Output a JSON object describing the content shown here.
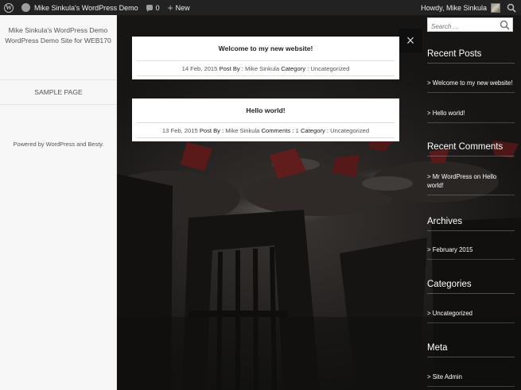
{
  "admin_bar": {
    "wp_logo": "W",
    "site_name": "Mike Sinkula's WordPress Demo",
    "comments_count": "0",
    "new_label": "New",
    "howdy": "Howdy, Mike Sinkula",
    "icons": [
      "wordpress-logo-icon",
      "dashboard-icon",
      "comment-bubble-icon",
      "plus-icon",
      "avatar",
      "search-icon"
    ]
  },
  "left_sidebar": {
    "site_title": "Mike Sinkula's WordPress Demo",
    "site_description": "WordPress Demo Site for WEB170",
    "nav": [
      {
        "label": "SAMPLE PAGE"
      }
    ],
    "powered_by": "Powered by WordPress and Besty."
  },
  "posts": [
    {
      "title": "Welcome to my new website!",
      "date": "14 Feb, 2015",
      "post_by_label": "Post By :",
      "author": "Mike Sinkula",
      "category_label": "Category :",
      "category": "Uncategorized",
      "comments_label": "",
      "comments": ""
    },
    {
      "title": "Hello world!",
      "date": "13 Feb, 2015",
      "post_by_label": "Post By :",
      "author": "Mike Sinkula",
      "category_label": "Category :",
      "category": "Uncategorized",
      "comments_label": "Comments :",
      "comments": "1"
    }
  ],
  "overlay": {
    "close_symbol": "×"
  },
  "right_sidebar": {
    "search_placeholder": "Search …",
    "recent_posts": {
      "heading": "Recent Posts",
      "items": [
        "> Welcome to my new website!",
        "> Hello world!"
      ]
    },
    "recent_comments": {
      "heading": "Recent Comments",
      "items": [
        "> Mr WordPress on Hello world!"
      ]
    },
    "archives": {
      "heading": "Archives",
      "items": [
        "> February 2015"
      ]
    },
    "categories": {
      "heading": "Categories",
      "items": [
        "> Uncategorized"
      ]
    },
    "meta": {
      "heading": "Meta",
      "items": [
        "> Site Admin"
      ]
    }
  },
  "colors": {
    "admin_bar_bg": "#222222",
    "sidebar_bg": "#f7f7f7",
    "card_bg": "#ffffff",
    "text_dark": "#222222"
  }
}
